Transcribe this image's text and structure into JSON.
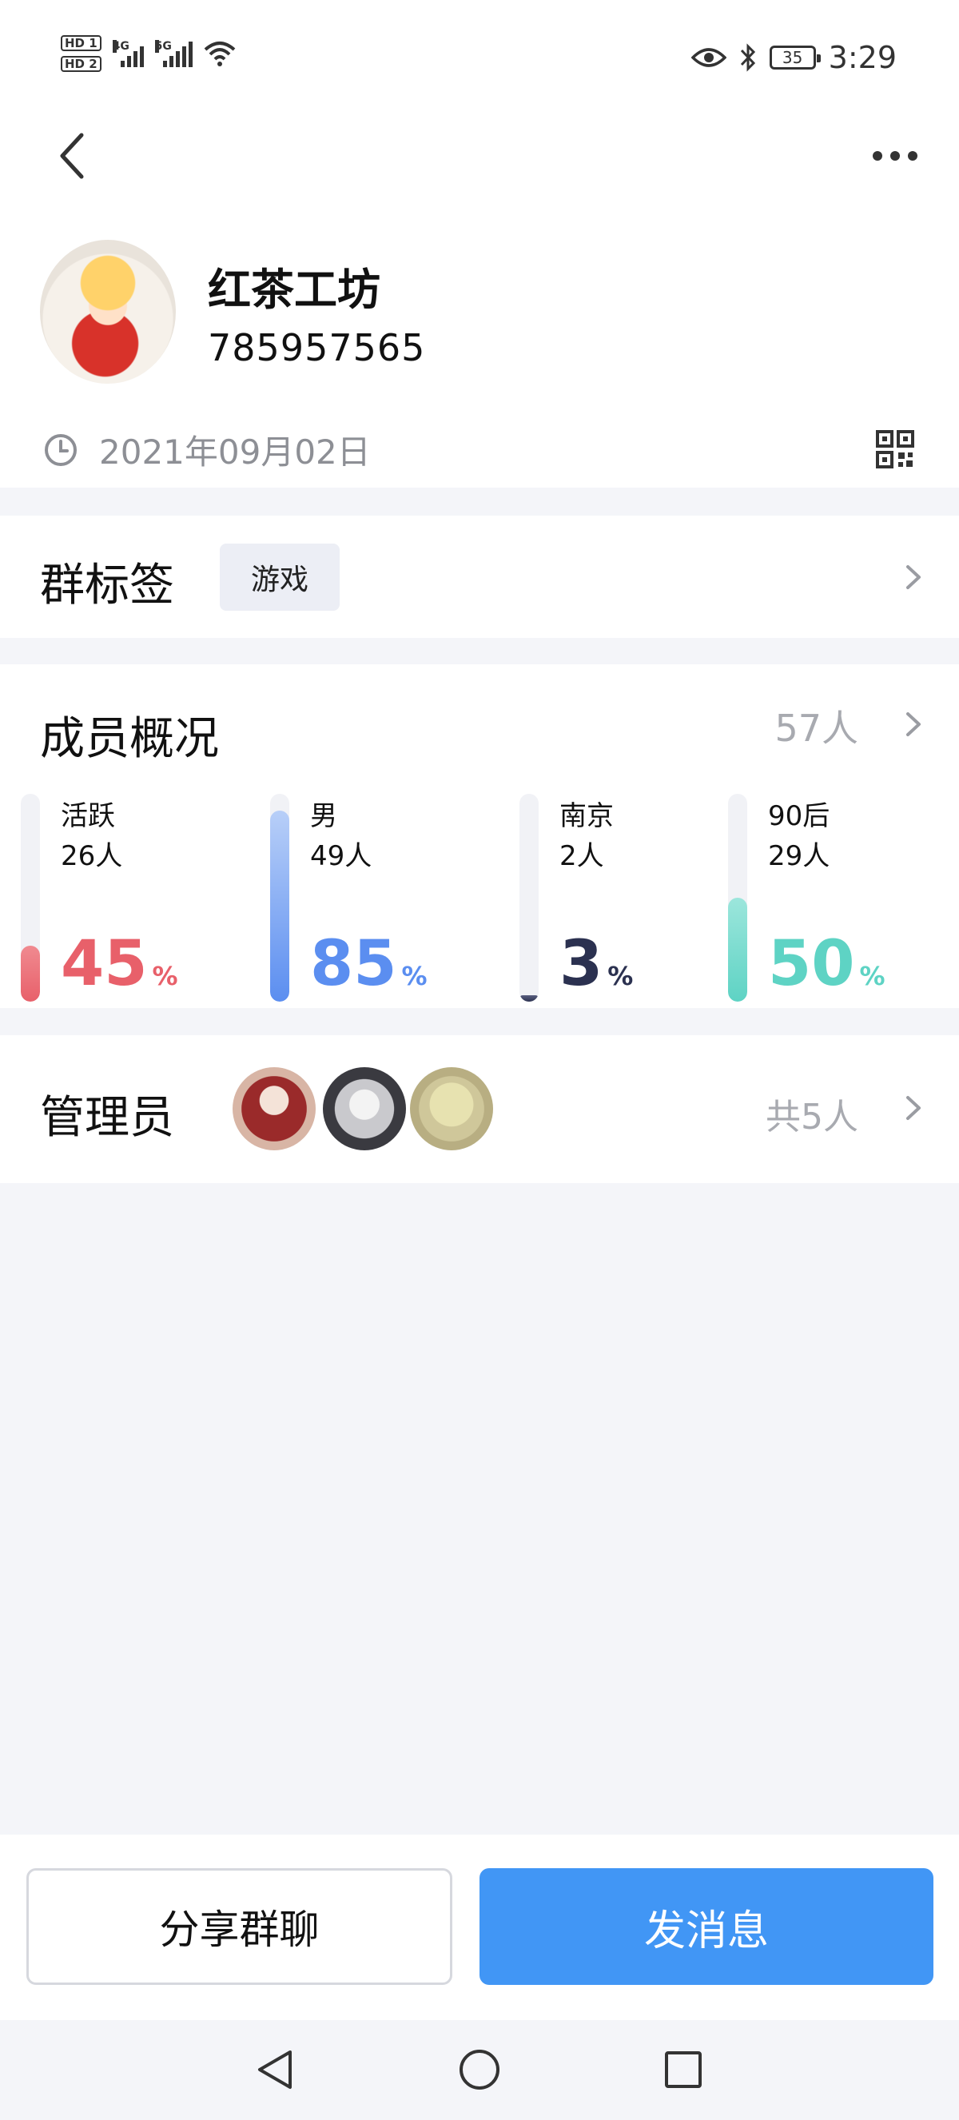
{
  "status_bar": {
    "sim1": "HD 1",
    "sim2": "HD 2",
    "net1": "4G",
    "net2": "5G",
    "battery": "35",
    "time": "3:29"
  },
  "group": {
    "name": "红茶工坊",
    "id": "785957565",
    "created_date": "2021年09月02日"
  },
  "tags": {
    "title": "群标签",
    "items": [
      "游戏"
    ]
  },
  "members": {
    "title": "成员概况",
    "total": "57人",
    "stats": [
      {
        "label": "活跃",
        "count": "26人",
        "percent": "45",
        "unit": "%",
        "level": 0.27,
        "color": "#e8606a",
        "color_light": "#f08a90"
      },
      {
        "label": "男",
        "count": "49人",
        "percent": "85",
        "unit": "%",
        "level": 0.92,
        "color": "#5b8ef0",
        "color_light": "#b8cff8"
      },
      {
        "label": "南京",
        "count": "2人",
        "percent": "3",
        "unit": "%",
        "level": 0.03,
        "color": "#2b3150",
        "color_light": "#5a6080"
      },
      {
        "label": "90后",
        "count": "29人",
        "percent": "50",
        "unit": "%",
        "level": 0.5,
        "color": "#5ed3c4",
        "color_light": "#9ce6dc"
      }
    ]
  },
  "admins": {
    "title": "管理员",
    "count": "共5人",
    "avatars": [
      "admin-avatar-1",
      "admin-avatar-2",
      "admin-avatar-3"
    ]
  },
  "actions": {
    "share": "分享群聊",
    "send": "发消息"
  },
  "colors": {
    "primary": "#4196f5",
    "muted_text": "#a8aab0",
    "page_bg": "#f4f5f9"
  }
}
